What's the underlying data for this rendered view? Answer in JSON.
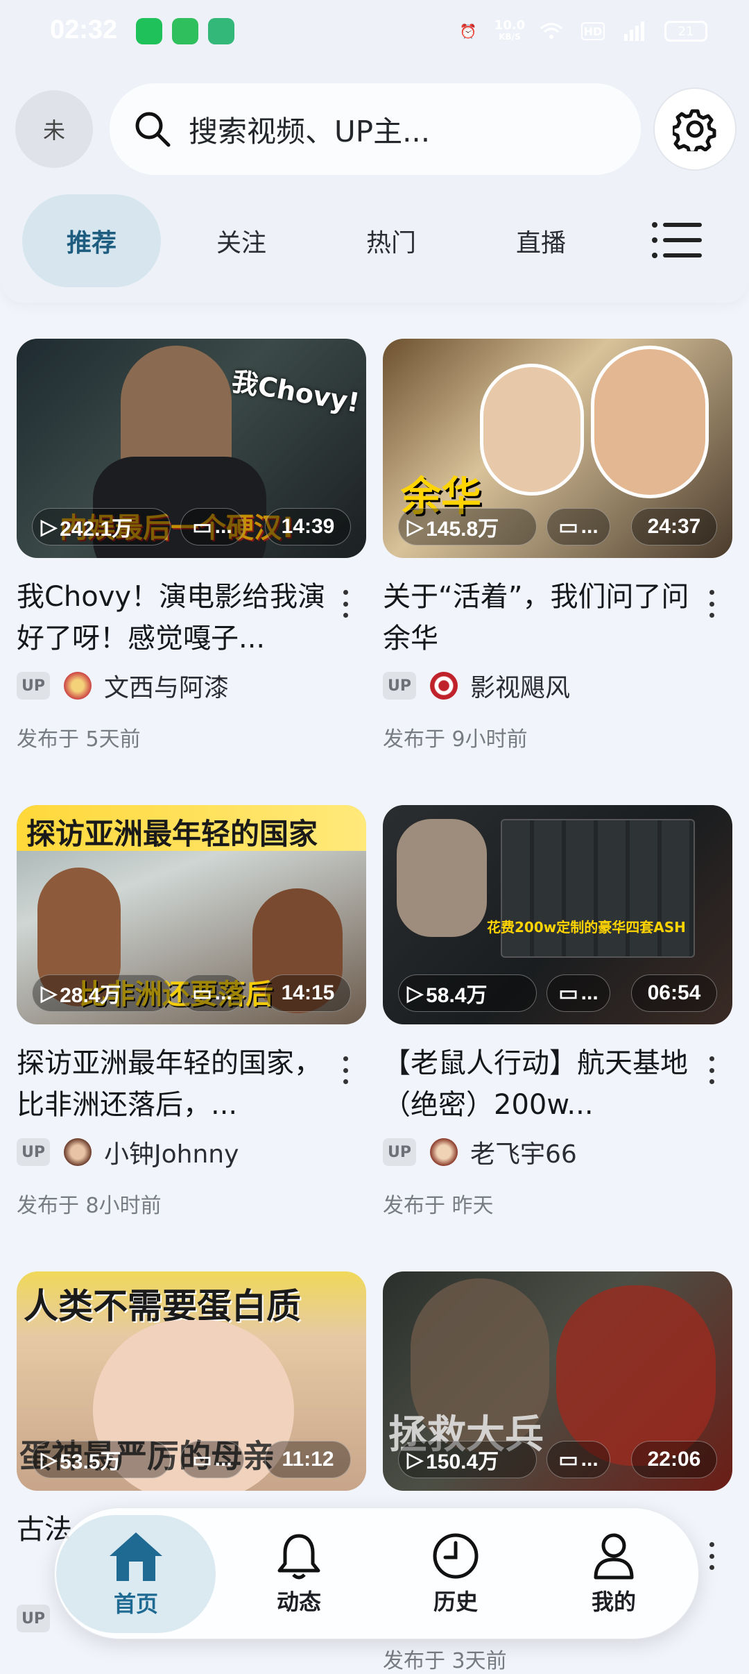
{
  "status": {
    "time": "02:32",
    "net_speed": "10.0",
    "net_unit": "KB/S",
    "battery": "21"
  },
  "header": {
    "avatar_text": "未",
    "search_placeholder": "搜索视频、UP主..."
  },
  "tabs": [
    {
      "label": "推荐",
      "active": true
    },
    {
      "label": "关注",
      "active": false
    },
    {
      "label": "热门",
      "active": false
    },
    {
      "label": "直播",
      "active": false
    }
  ],
  "videos": [
    {
      "title": "我Chovy！演电影给我演好了呀！感觉嘎子...",
      "views": "242.1万",
      "comments": "...",
      "duration": "14:39",
      "up_badge": "UP",
      "uploader": "文西与阿漆",
      "published": "发布于 5天前",
      "thumb_caption": "我Chovy!",
      "thumb_caption2": "内娱最后一个硬汉!"
    },
    {
      "title": "关于“活着”，我们问了问余华",
      "views": "145.8万",
      "comments": "...",
      "duration": "24:37",
      "up_badge": "UP",
      "uploader": "影视飓风",
      "published": "发布于 9小时前",
      "thumb_caption": "余华"
    },
    {
      "title": "探访亚洲最年轻的国家，比非洲还落后，...",
      "views": "28.4万",
      "comments": "...",
      "duration": "14:15",
      "up_badge": "UP",
      "uploader": "小钟Johnny",
      "published": "发布于 8小时前",
      "thumb_caption": "探访亚洲最年轻的国家",
      "thumb_caption2": "比非洲还要落后"
    },
    {
      "title": "【老鼠人行动】航天基地（绝密）200w...",
      "views": "58.4万",
      "comments": "...",
      "duration": "06:54",
      "up_badge": "UP",
      "uploader": "老飞宇66",
      "published": "发布于 昨天",
      "thumb_caption": "花费200w定制的豪华四套ASH"
    },
    {
      "title": "古法...需...",
      "views": "53.5万",
      "comments": "...",
      "duration": "11:12",
      "up_badge": "UP",
      "uploader": "",
      "published": "",
      "thumb_caption": "人类不需要蛋白质",
      "thumb_caption2": "蛋神最严厉的母亲"
    },
    {
      "title": "",
      "views": "150.4万",
      "comments": "...",
      "duration": "22:06",
      "up_badge": "",
      "uploader": "",
      "published": "发布于 3天前",
      "thumb_caption": "拯救大兵"
    }
  ],
  "nav": [
    {
      "label": "首页",
      "icon": "home-icon",
      "active": true
    },
    {
      "label": "动态",
      "icon": "bell-icon",
      "active": false
    },
    {
      "label": "历史",
      "icon": "clock-icon",
      "active": false
    },
    {
      "label": "我的",
      "icon": "person-icon",
      "active": false
    }
  ],
  "colors": {
    "accent": "#1f6a92",
    "active_tab_bg": "#d7e6ee",
    "background": "#f1f4fa"
  }
}
